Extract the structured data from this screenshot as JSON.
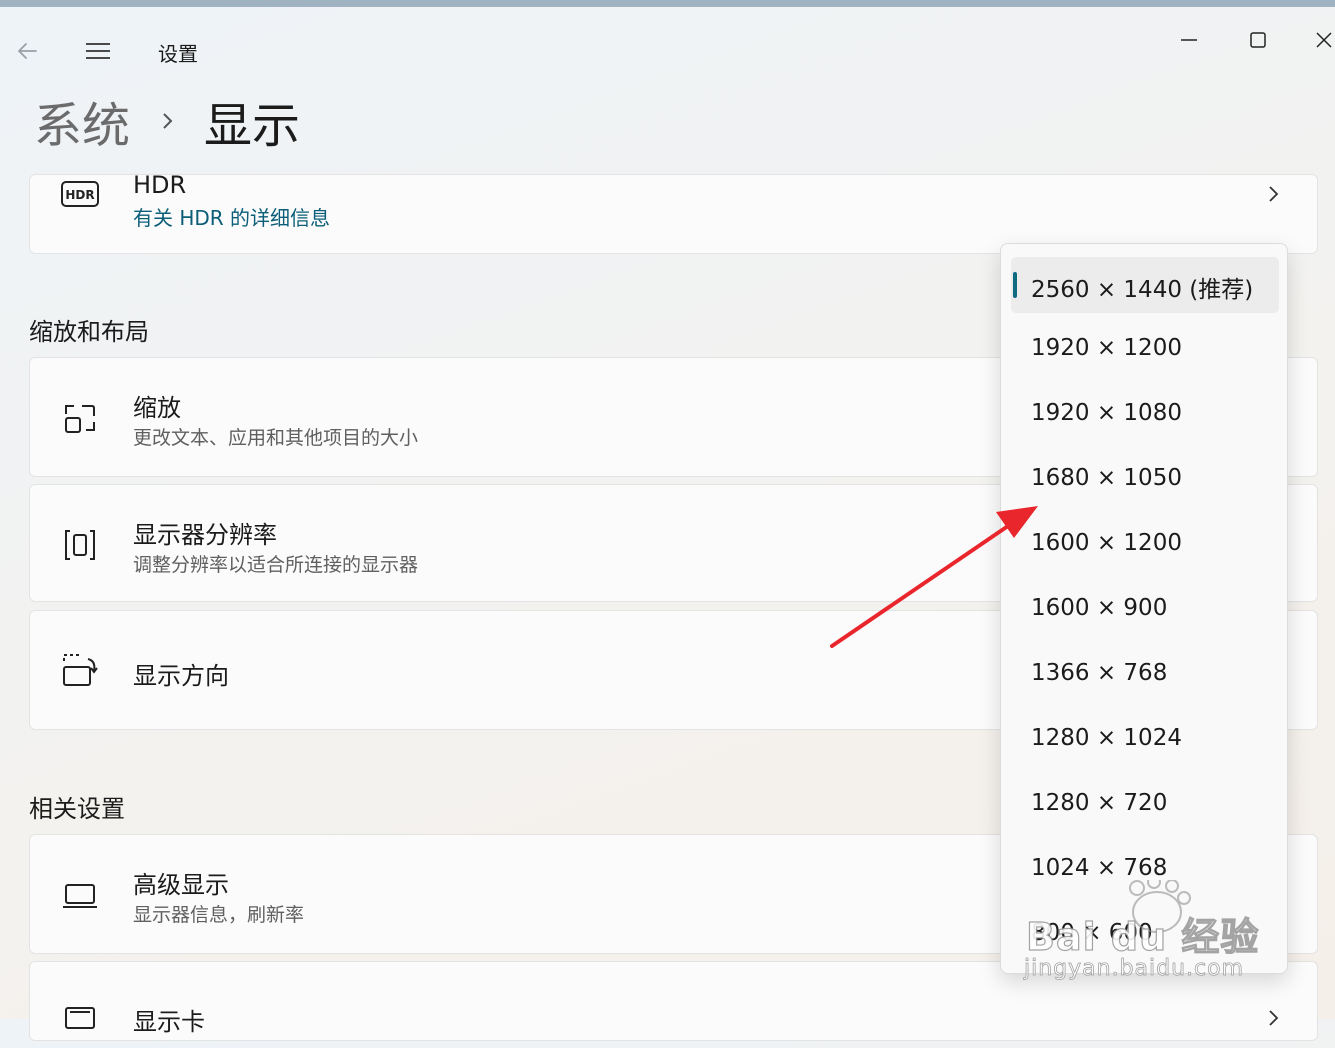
{
  "window": {
    "title": "设置",
    "controls": {
      "minimize_icon": "minimize-icon",
      "maximize_icon": "maximize-icon",
      "close_icon": "close-icon"
    }
  },
  "breadcrumb": {
    "parent": "系统",
    "current": "显示"
  },
  "hdr_card": {
    "title": "HDR",
    "link": "有关 HDR 的详细信息"
  },
  "sections": {
    "scale_layout": "缩放和布局",
    "related": "相关设置"
  },
  "scale_layout_items": [
    {
      "title": "缩放",
      "subtitle": "更改文本、应用和其他项目的大小"
    },
    {
      "title": "显示器分辨率",
      "subtitle": "调整分辨率以适合所连接的显示器"
    },
    {
      "title": "显示方向",
      "subtitle": ""
    }
  ],
  "related_items": [
    {
      "title": "高级显示",
      "subtitle": "显示器信息，刷新率"
    },
    {
      "title": "显示卡",
      "subtitle": ""
    }
  ],
  "resolution_dropdown": {
    "selected_index": 0,
    "options": [
      "2560 × 1440 (推荐)",
      "1920 × 1200",
      "1920 × 1080",
      "1680 × 1050",
      "1600 × 1200",
      "1600 × 900",
      "1366 × 768",
      "1280 × 1024",
      "1280 × 720",
      "1024 × 768",
      "800 × 600"
    ]
  },
  "watermark": {
    "brand": "Bai du 经验",
    "url": "jingyan.baidu.com"
  },
  "colors": {
    "accent": "#0f6b80",
    "link": "#0b5d78",
    "annotation_arrow": "#e8262b"
  }
}
